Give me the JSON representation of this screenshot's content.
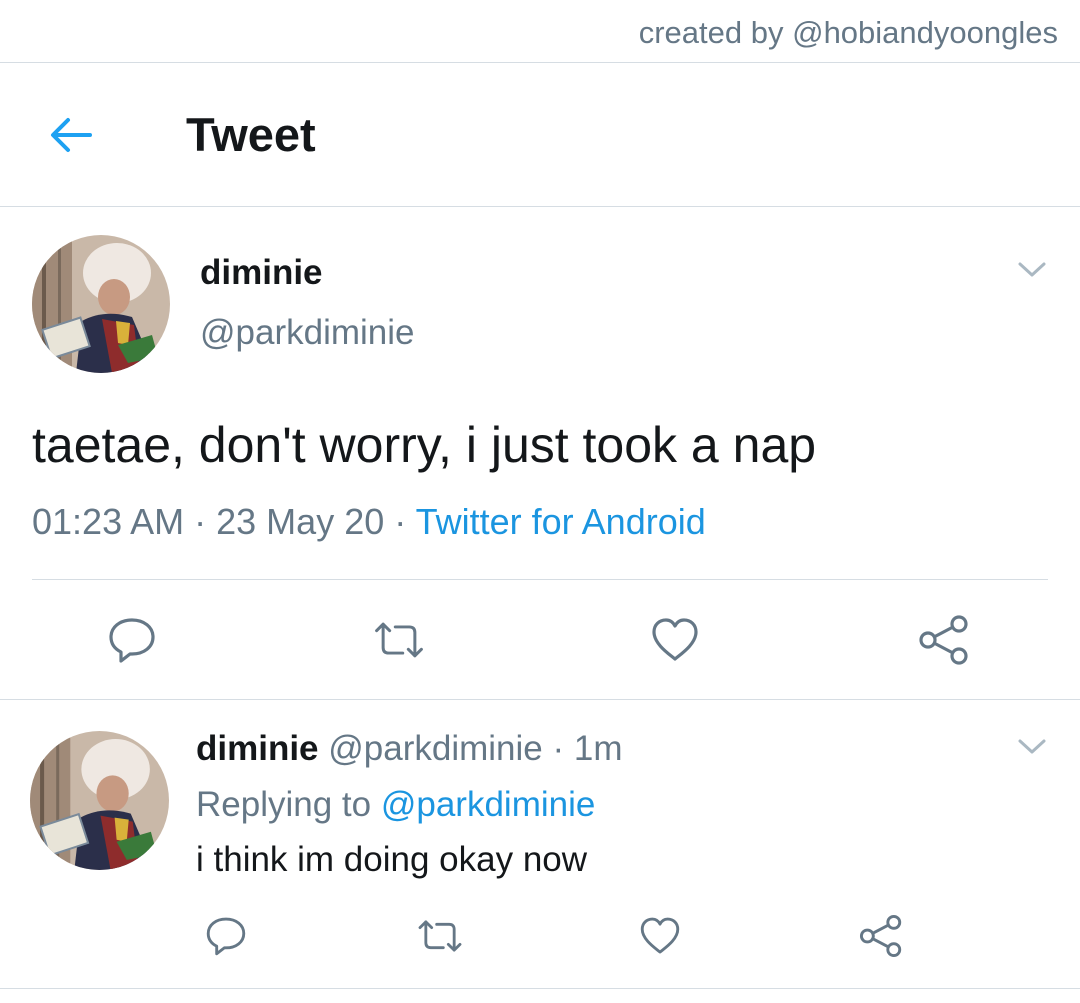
{
  "credit": {
    "text": "created by @hobiandyoongles"
  },
  "header": {
    "title": "Tweet",
    "back_icon": "arrow-left-icon",
    "accent_color": "#1da1f2"
  },
  "main_tweet": {
    "author_name": "diminie",
    "author_handle": "@parkdiminie",
    "text": "taetae, don't worry, i just took a nap",
    "time": "01:23 AM",
    "date": "23 May 20",
    "source": "Twitter for Android",
    "separator": "·",
    "actions": [
      {
        "name": "reply",
        "icon": "comment-icon"
      },
      {
        "name": "retweet",
        "icon": "retweet-icon"
      },
      {
        "name": "like",
        "icon": "heart-icon"
      },
      {
        "name": "share",
        "icon": "share-icon"
      }
    ]
  },
  "reply_tweet": {
    "author_name": "diminie",
    "author_handle": "@parkdiminie",
    "separator": "·",
    "time_ago": "1m",
    "replying_prefix": "Replying to",
    "replying_to": "@parkdiminie",
    "text": "i think im doing okay now",
    "actions": [
      {
        "name": "reply",
        "icon": "comment-icon"
      },
      {
        "name": "retweet",
        "icon": "retweet-icon"
      },
      {
        "name": "like",
        "icon": "heart-icon"
      },
      {
        "name": "share",
        "icon": "share-icon"
      }
    ]
  },
  "colors": {
    "text_primary": "#14171a",
    "text_secondary": "#657786",
    "link": "#1b95e0",
    "divider": "#d6dde3"
  }
}
